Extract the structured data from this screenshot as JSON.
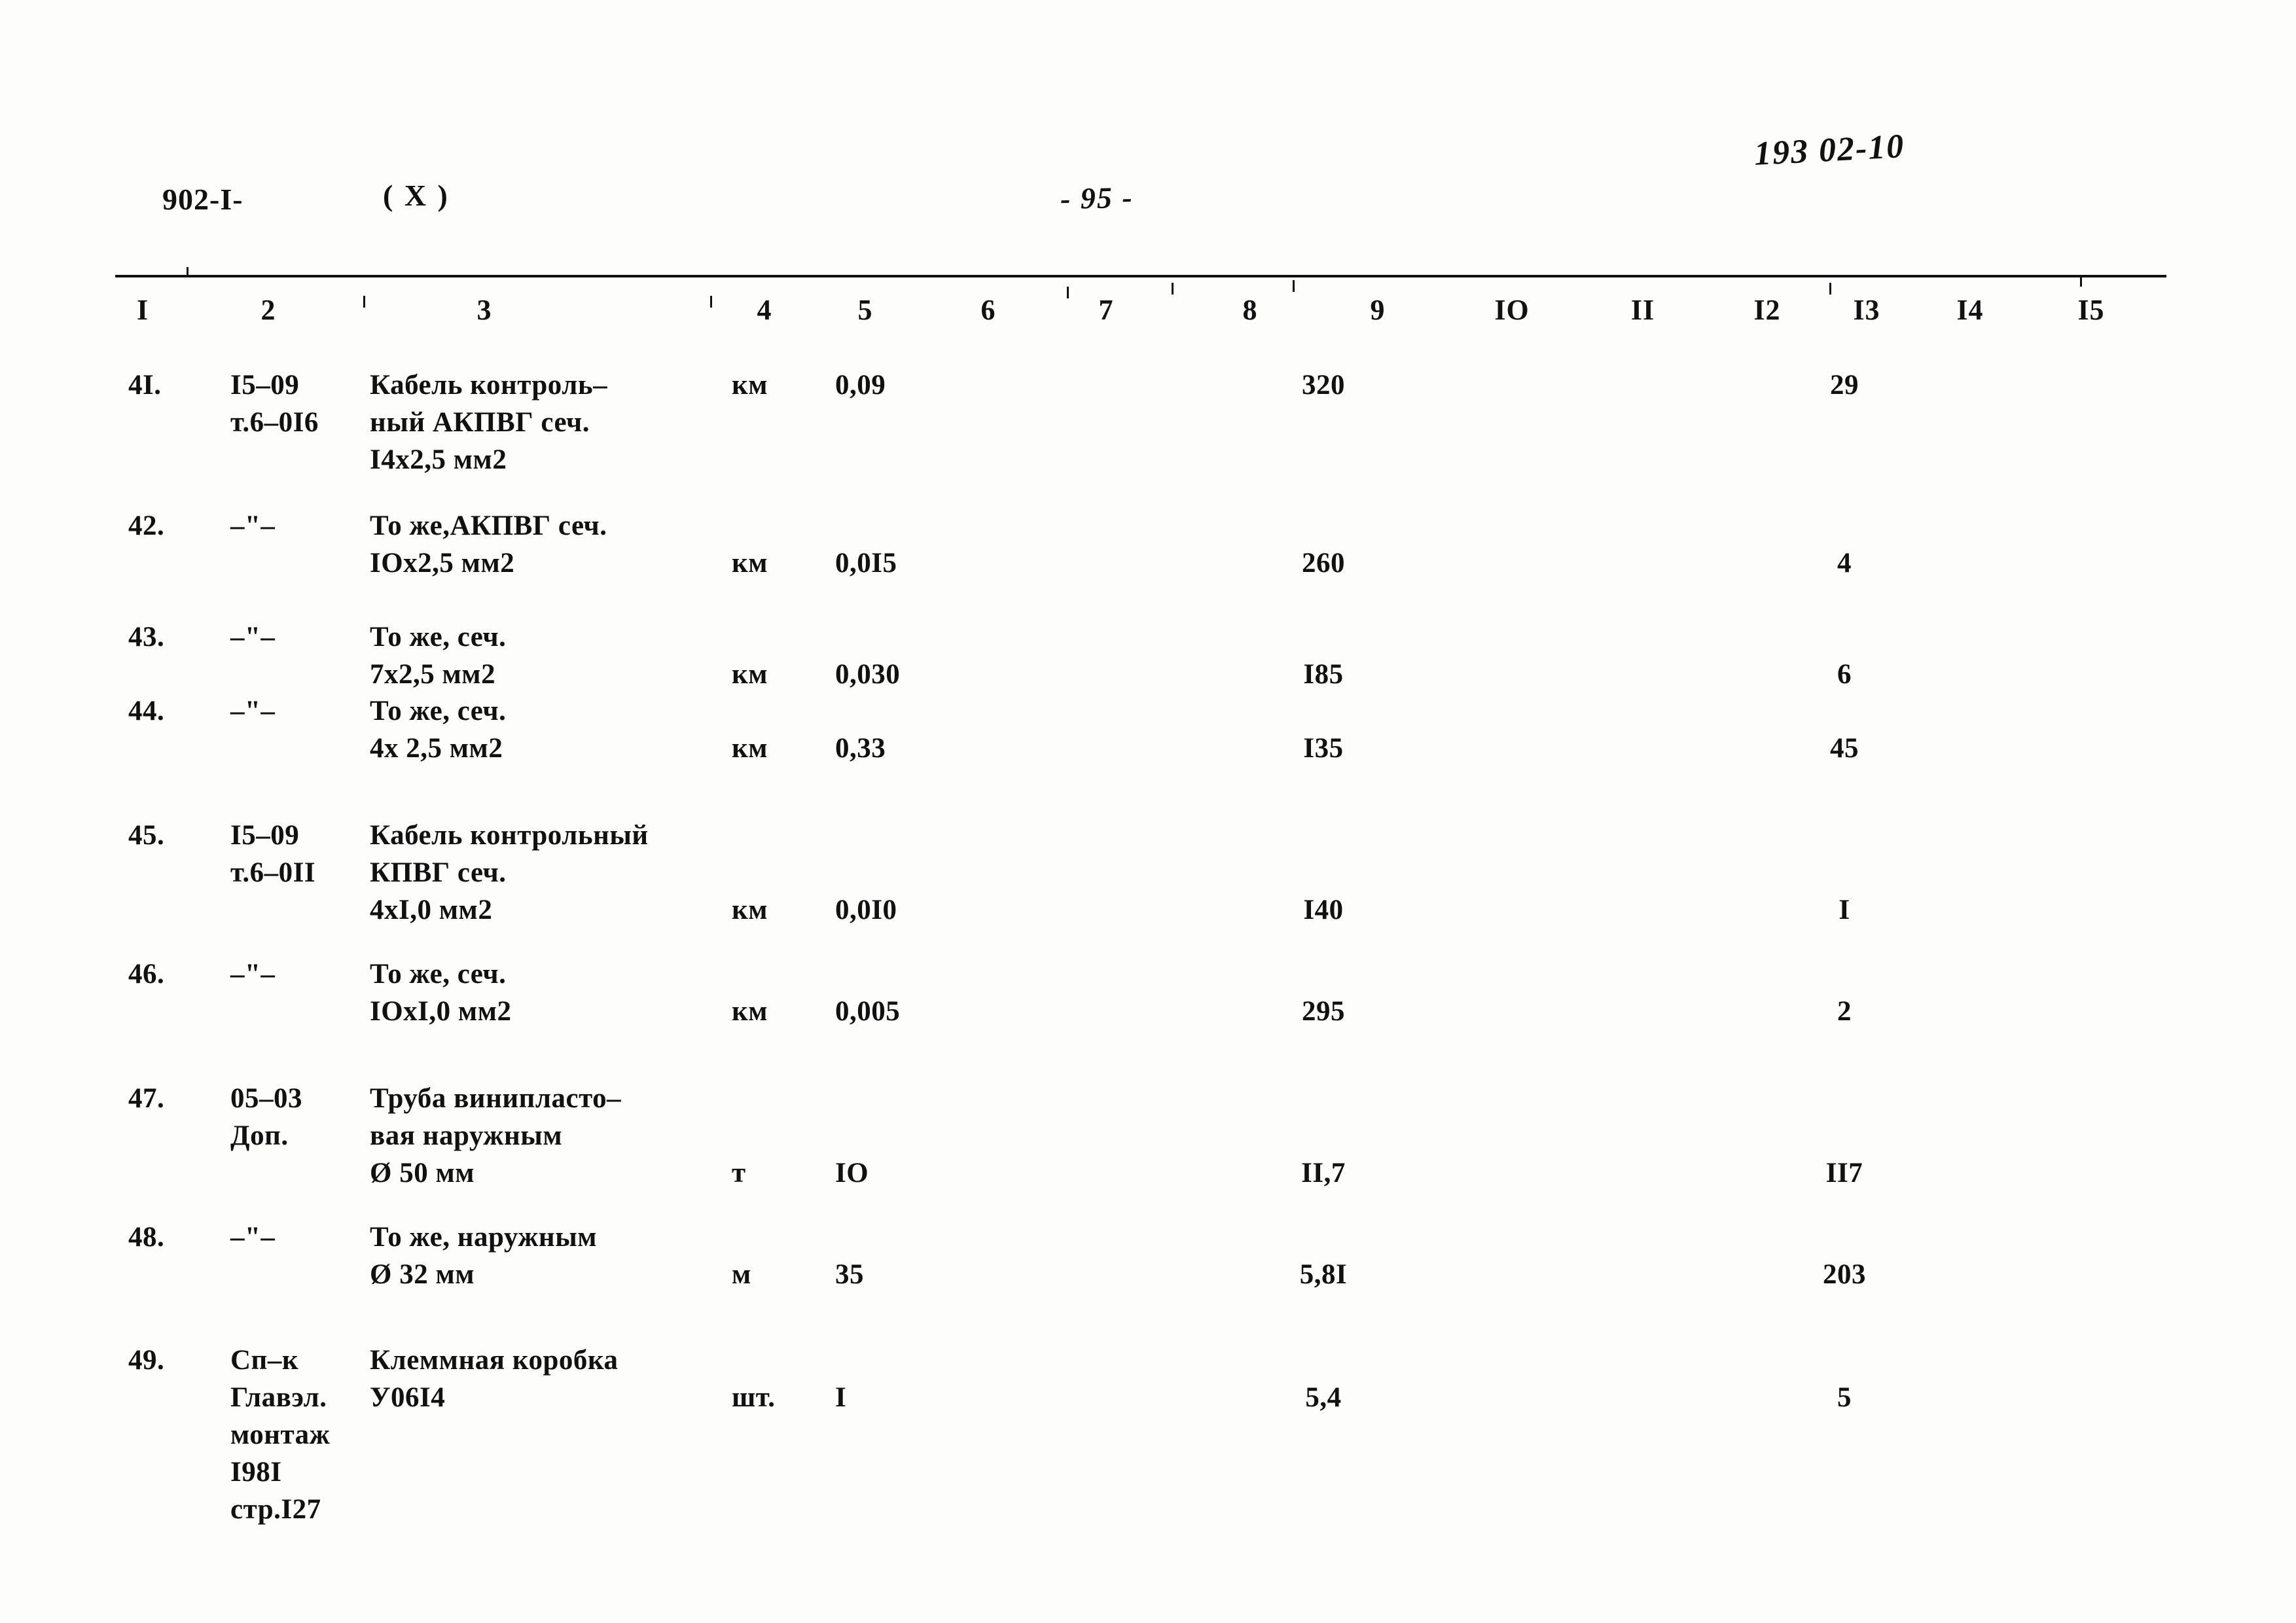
{
  "header": {
    "doc_code": "902-I-",
    "variant": "( X )",
    "page_number": "- 95 -",
    "hand_note": "193 02-10"
  },
  "table": {
    "column_headers": [
      "I",
      "2",
      "3",
      "4",
      "5",
      "6",
      "7",
      "8",
      "9",
      "IO",
      "II",
      "I2",
      "I3",
      "I4",
      "I5"
    ],
    "rows": [
      {
        "num": "4I.",
        "code_lines": [
          "I5–09",
          "т.6–0I6"
        ],
        "name_lines": [
          "Кабель контроль–",
          "ный АКПВГ сеч.",
          "I4х2,5 мм2"
        ],
        "unit": "км",
        "qty": "0,09",
        "price": "320",
        "total": "29"
      },
      {
        "num": "42.",
        "code_lines": [
          "–\"–"
        ],
        "name_lines": [
          "То же,АКПВГ сеч.",
          "IOх2,5 мм2"
        ],
        "unit": "км",
        "qty": "0,0I5",
        "price": "260",
        "total": "4"
      },
      {
        "num": "43.",
        "code_lines": [
          "–\"–"
        ],
        "name_lines": [
          "То же, сеч.",
          "7х2,5 мм2"
        ],
        "unit": "км",
        "qty": "0,030",
        "price": "I85",
        "total": "6"
      },
      {
        "num": "44.",
        "code_lines": [
          "–\"–"
        ],
        "name_lines": [
          "То же, сеч.",
          "4х 2,5 мм2"
        ],
        "unit": "км",
        "qty": "0,33",
        "price": "I35",
        "total": "45"
      },
      {
        "num": "45.",
        "code_lines": [
          "I5–09",
          "т.6–0II"
        ],
        "name_lines": [
          "Кабель контрольный",
          "КПВГ сеч.",
          "4хI,0 мм2"
        ],
        "unit": "км",
        "qty": "0,0I0",
        "price": "I40",
        "total": "I"
      },
      {
        "num": "46.",
        "code_lines": [
          "–\"–"
        ],
        "name_lines": [
          "То же, сеч.",
          "IOхI,0 мм2"
        ],
        "unit": "км",
        "qty": "0,005",
        "price": "295",
        "total": "2"
      },
      {
        "num": "47.",
        "code_lines": [
          "05–03",
          "Доп."
        ],
        "name_lines": [
          "Труба винипласто–",
          "вая наружным",
          "Ø 50 мм"
        ],
        "unit": "т",
        "qty": "IO",
        "price": "II,7",
        "total": "II7"
      },
      {
        "num": "48.",
        "code_lines": [
          "–\"–"
        ],
        "name_lines": [
          "То же, наружным",
          "Ø 32 мм"
        ],
        "unit": "м",
        "qty": "35",
        "price": "5,8I",
        "total": "203"
      },
      {
        "num": "49.",
        "code_lines": [
          "Сп–к",
          "Главэл.",
          "монтаж",
          "I98I",
          "стр.I27"
        ],
        "name_lines": [
          "Клеммная коробка",
          "У06I4"
        ],
        "unit": "шт.",
        "qty": "I",
        "price": "5,4",
        "total": "5"
      }
    ]
  }
}
